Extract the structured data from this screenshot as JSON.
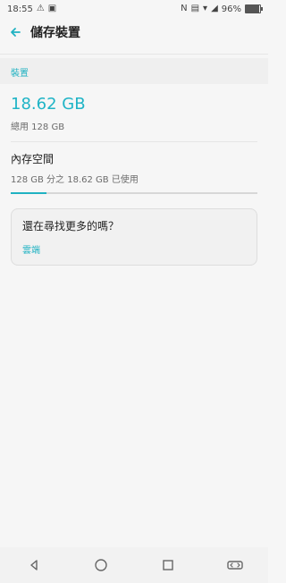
{
  "status": {
    "time": "18:55",
    "left_icons": [
      "warning-icon",
      "image-icon"
    ],
    "right_icons": [
      "nfc-icon",
      "volte-icon",
      "wifi-icon",
      "signal-icon"
    ],
    "battery_percent": "96%",
    "battery_level": 0.96
  },
  "appbar": {
    "title": "儲存裝置"
  },
  "section": {
    "label": "裝置"
  },
  "summary": {
    "used": "18.62 GB",
    "total": "總用 128 GB"
  },
  "internal": {
    "title": "內存空間",
    "detail": "128 GB 分之 18.62 GB 已使用",
    "progress": 0.1455
  },
  "card": {
    "question": "還在尋找更多的嗎？",
    "link": "雲端"
  },
  "colors": {
    "accent": "#20b2c2",
    "bg": "#f6f6f6"
  }
}
